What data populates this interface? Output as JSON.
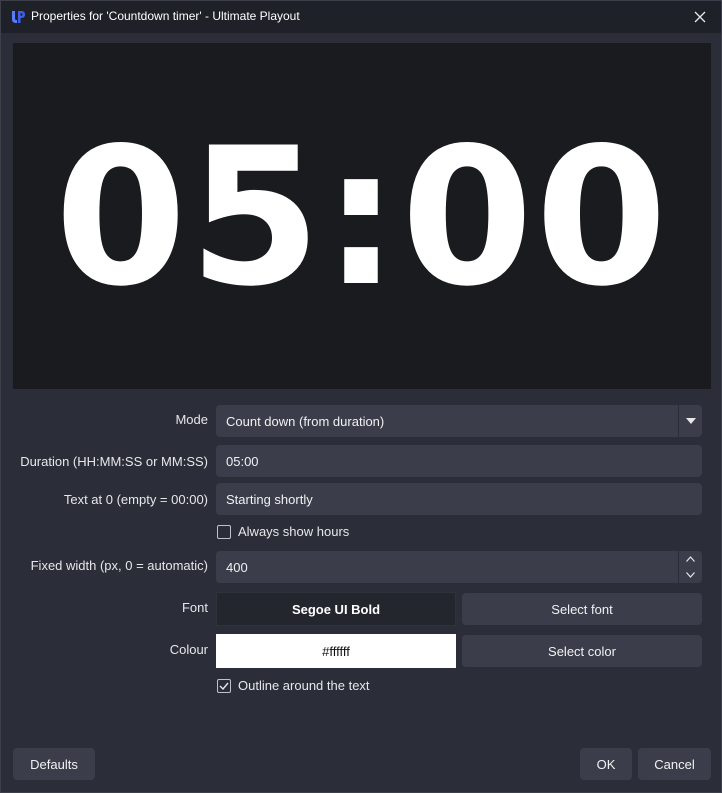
{
  "window": {
    "title": "Properties for 'Countdown timer' - Ultimate Playout",
    "app_icon": "up-logo-icon",
    "close_icon": "close-icon"
  },
  "preview": {
    "text": "05:00"
  },
  "form": {
    "mode": {
      "label": "Mode",
      "value": "Count down (from duration)"
    },
    "duration": {
      "label": "Duration (HH:MM:SS or MM:SS)",
      "value": "05:00"
    },
    "text_at_zero": {
      "label": "Text at 0 (empty = 00:00)",
      "value": "Starting shortly"
    },
    "always_show_hours": {
      "label": "Always show hours",
      "checked": false
    },
    "fixed_width": {
      "label": "Fixed width (px, 0 = automatic)",
      "value": "400"
    },
    "font": {
      "label": "Font",
      "value": "Segoe UI Bold",
      "button": "Select font"
    },
    "colour": {
      "label": "Colour",
      "value": "#ffffff",
      "button": "Select color"
    },
    "outline": {
      "label": "Outline around the text",
      "checked": true
    }
  },
  "footer": {
    "defaults": "Defaults",
    "ok": "OK",
    "cancel": "Cancel"
  },
  "colors": {
    "background": "#2b2e38",
    "titlebar": "#1f2128",
    "preview_bg": "#1a1b1f",
    "field_bg": "#3b3e4a",
    "accent_logo": "#4a6cf7"
  }
}
